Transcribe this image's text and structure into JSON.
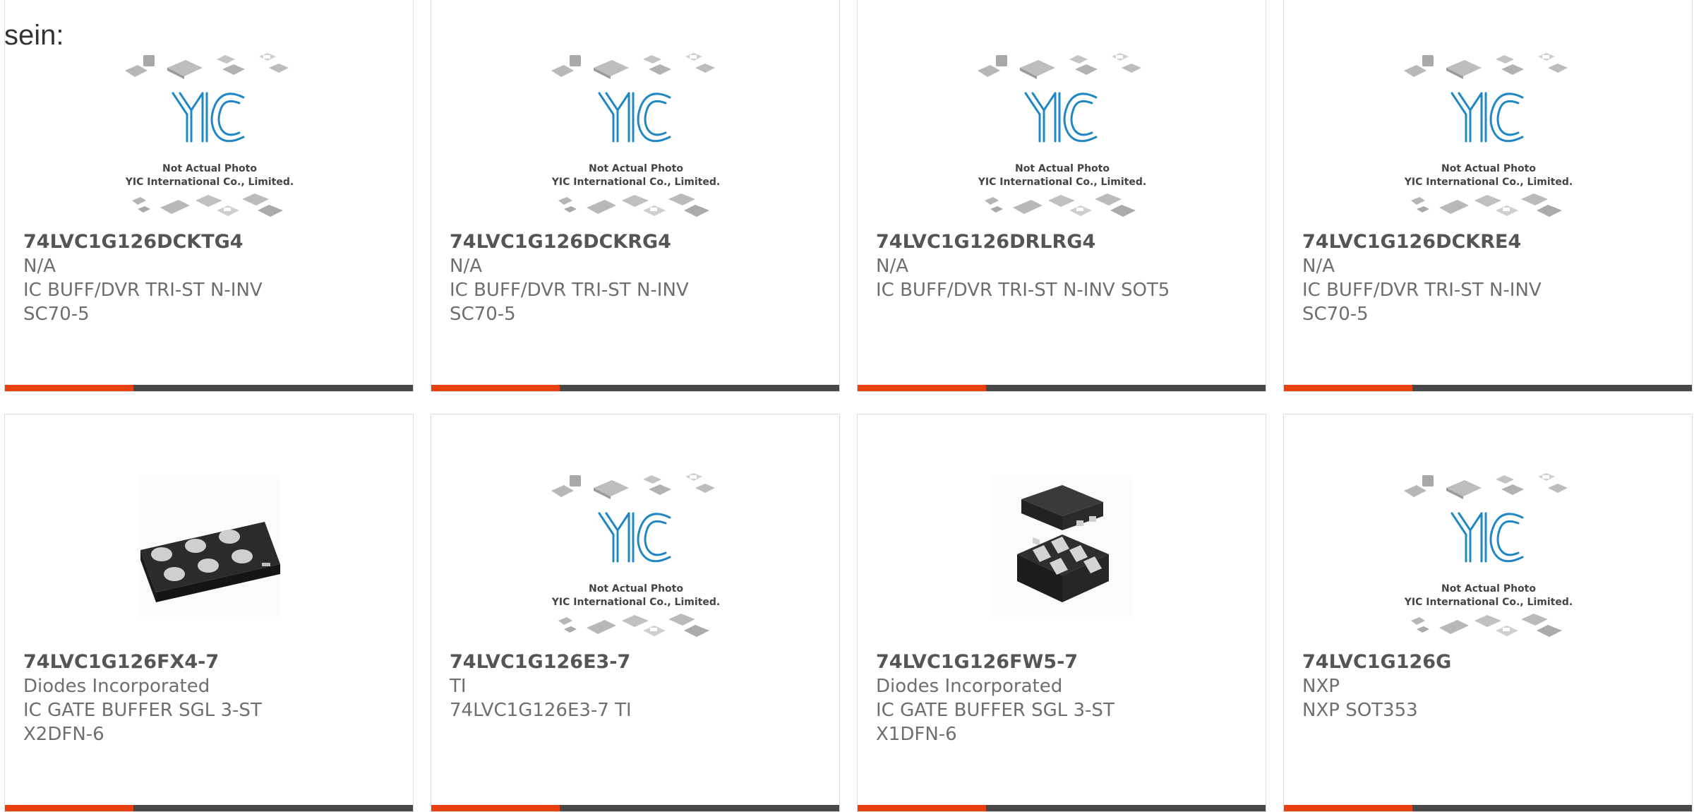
{
  "page": {
    "intro_text": "sein:"
  },
  "placeholder_image": {
    "line1": "Not Actual Photo",
    "line2": "YIC International Co., Limited."
  },
  "colors": {
    "accent": "#e8400e",
    "bar": "#474747",
    "border": "#dcdcdc",
    "logo": "#1f88c4"
  },
  "products": [
    {
      "part": "74LVC1G126DCKTG4",
      "maker": "N/A",
      "desc1": "IC BUFF/DVR TRI-ST N-INV",
      "desc2": "SC70-5",
      "image": "placeholder"
    },
    {
      "part": "74LVC1G126DCKRG4",
      "maker": "N/A",
      "desc1": "IC BUFF/DVR TRI-ST N-INV",
      "desc2": "SC70-5",
      "image": "placeholder"
    },
    {
      "part": "74LVC1G126DRLRG4",
      "maker": "N/A",
      "desc1": "IC BUFF/DVR TRI-ST N-INV SOT5",
      "desc2": "",
      "image": "placeholder"
    },
    {
      "part": "74LVC1G126DCKRE4",
      "maker": "N/A",
      "desc1": "IC BUFF/DVR TRI-ST N-INV",
      "desc2": "SC70-5",
      "image": "placeholder"
    },
    {
      "part": "74LVC1G126FX4-7",
      "maker": "Diodes Incorporated",
      "desc1": "IC GATE BUFFER SGL 3-ST",
      "desc2": "X2DFN-6",
      "image": "x2dfn-package"
    },
    {
      "part": "74LVC1G126E3-7",
      "maker": "TI",
      "desc1": "74LVC1G126E3-7 TI",
      "desc2": "",
      "image": "placeholder"
    },
    {
      "part": "74LVC1G126FW5-7",
      "maker": "Diodes Incorporated",
      "desc1": "IC GATE BUFFER SGL 3-ST",
      "desc2": "X1DFN-6",
      "image": "x1dfn-package"
    },
    {
      "part": "74LVC1G126G",
      "maker": "NXP",
      "desc1": "NXP SOT353",
      "desc2": "",
      "image": "placeholder"
    }
  ]
}
